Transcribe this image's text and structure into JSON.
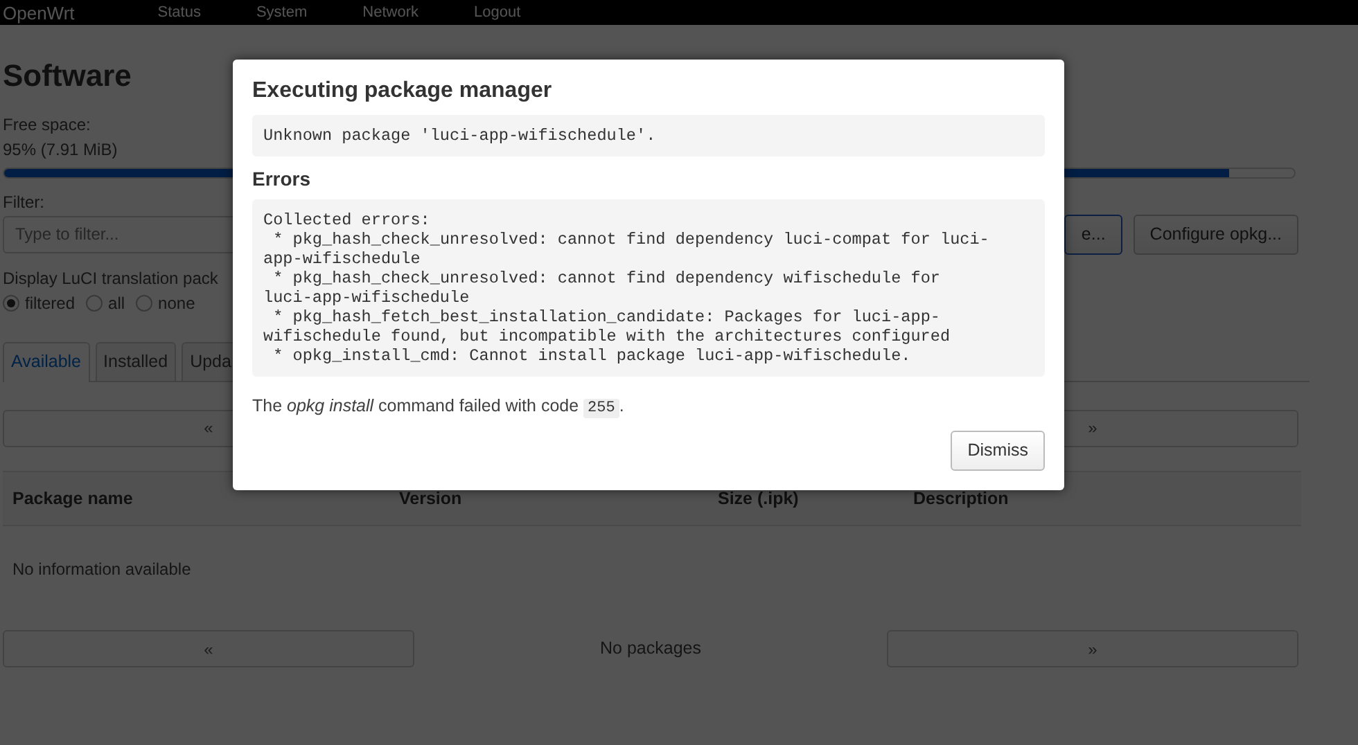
{
  "navbar": {
    "brand": "OpenWrt",
    "items": [
      "Status",
      "System",
      "Network",
      "Logout"
    ]
  },
  "page": {
    "title": "Software",
    "free_space": {
      "label": "Free space:",
      "reading": "95% (7.91 MiB)",
      "level": 0.95
    },
    "filter": {
      "label": "Filter:",
      "placeholder": "Type to filter..."
    },
    "actions": [
      {
        "label": "e..."
      },
      {
        "label": "Configure opkg..."
      }
    ],
    "translations": {
      "label": "Display LuCI translation pack",
      "options": [
        {
          "label": "filtered",
          "selected": true
        },
        {
          "label": "all",
          "selected": false
        },
        {
          "label": "none",
          "selected": false
        }
      ]
    },
    "tabs": [
      {
        "label": "Available",
        "selected": true
      },
      {
        "label": "Installed",
        "selected": false
      },
      {
        "label": "Upda",
        "selected": false
      }
    ],
    "pager_top": {
      "prev": "«",
      "next": "»"
    },
    "table": {
      "columns": [
        "Package name",
        "Version",
        "Size (.ipk)",
        "Description"
      ],
      "empty": "No information available"
    },
    "pager_bottom": {
      "prev": "«",
      "status": "No packages",
      "next": "»"
    }
  },
  "modal": {
    "title": "Executing package manager",
    "output": "Unknown package 'luci-app-wifischedule'.",
    "errors_title": "Errors",
    "errors": "Collected errors:\n * pkg_hash_check_unresolved: cannot find dependency luci-compat for luci-app-wifischedule\n * pkg_hash_check_unresolved: cannot find dependency wifischedule for luci-app-wifischedule\n * pkg_hash_fetch_best_installation_candidate: Packages for luci-app-wifischedule found, but incompatible with the architectures configured\n * opkg_install_cmd: Cannot install package luci-app-wifischedule.",
    "exit_message": "The *opkg install* command failed with code",
    "exit_code": "255",
    "exit_suffix": ".",
    "dismiss": "Dismiss"
  }
}
